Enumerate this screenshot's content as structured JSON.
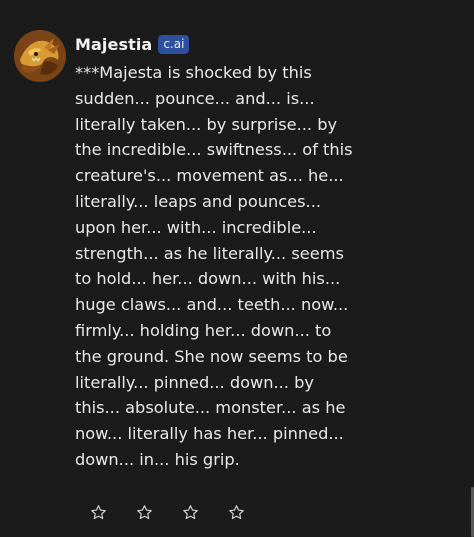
{
  "message": {
    "author": "Majestia",
    "badge": "c.ai",
    "lines": [
      "***Majesta is shocked by this",
      "sudden... pounce... and... is...",
      "literally taken... by surprise... by",
      "the incredible... swiftness... of this",
      "creature's... movement as... he...",
      "literally... leaps and pounces...",
      "upon her... with... incredible...",
      "strength... as he literally... seems",
      "to hold... her... down... with his...",
      "huge claws... and... teeth... now...",
      "firmly... holding her... down... to",
      "the ground. She now seems to be",
      "literally... pinned... down... by",
      "this... absolute... monster... as he",
      "now... literally has her... pinned...",
      "down... in... his grip."
    ]
  },
  "rating": {
    "icon": "star-outline-icon",
    "count": 4,
    "selected": 0
  },
  "colors": {
    "background": "#1b1b1c",
    "text": "#e9e9e9",
    "badge": "#2e4f9e"
  }
}
